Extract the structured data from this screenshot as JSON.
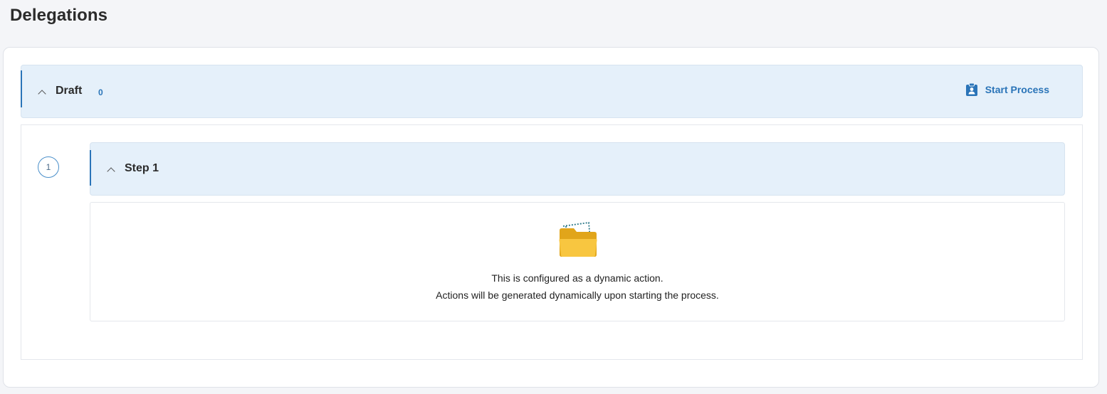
{
  "page": {
    "title": "Delegations"
  },
  "draft": {
    "label": "Draft",
    "count": "0",
    "start_process_label": "Start Process",
    "start_process_icon": "clipboard-person-icon"
  },
  "step": {
    "number": "1",
    "label": "Step 1",
    "empty_state": {
      "icon": "open-folder-icon",
      "line1": "This is configured as a dynamic action.",
      "line2": "Actions will be generated dynamically upon starting the process."
    }
  },
  "colors": {
    "accent": "#2a74b8",
    "header_bg": "#e5f0fa",
    "page_bg": "#f4f5f8"
  }
}
